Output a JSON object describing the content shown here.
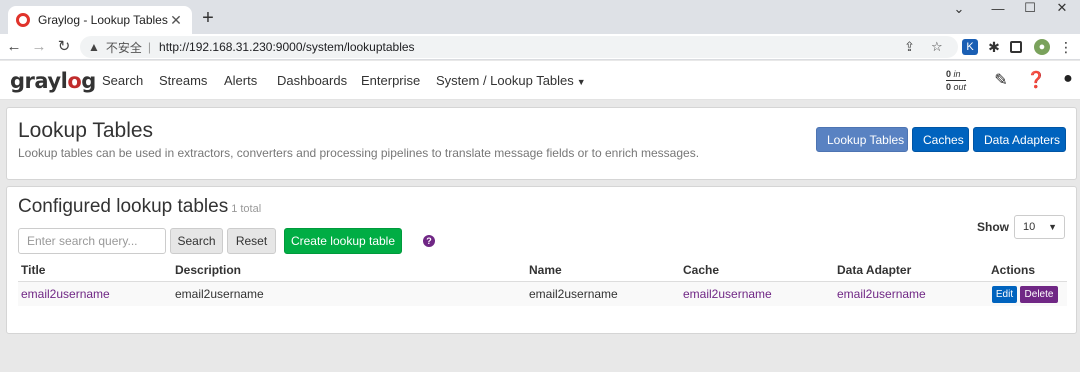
{
  "browser": {
    "tab_title": "Graylog - Lookup Tables",
    "tab_close": "✕",
    "new_tab": "+",
    "controls": {
      "more": "⌄",
      "minimize": "—",
      "maximize": "☐",
      "close": "✕"
    },
    "insecure_label": "不安全",
    "separator": "|",
    "url": "http://192.168.31.230:9000/system/lookuptables"
  },
  "navbar": {
    "brand": {
      "pre": "grayl",
      "o": "o",
      "post": "g"
    },
    "items": [
      "Search",
      "Streams",
      "Alerts",
      "Dashboards",
      "Enterprise"
    ],
    "system_menu": "System / Lookup Tables",
    "throughput": {
      "in_value": "0",
      "in_label": "in",
      "out_value": "0",
      "out_label": "out"
    }
  },
  "header": {
    "title": "Lookup Tables",
    "description": "Lookup tables can be used in extractors, converters and processing pipelines to translate message fields or to enrich messages.",
    "buttons": {
      "lookup_tables": "Lookup Tables",
      "caches": "Caches",
      "data_adapters": "Data Adapters"
    }
  },
  "configured": {
    "title": "Configured lookup tables",
    "total": "1 total",
    "search_placeholder": "Enter search query...",
    "search_button": "Search",
    "reset_button": "Reset",
    "create_button": "Create lookup table",
    "help": "?",
    "show_label": "Show",
    "page_size": "10",
    "columns": {
      "title": "Title",
      "description": "Description",
      "name": "Name",
      "cache": "Cache",
      "data_adapter": "Data Adapter",
      "actions": "Actions"
    },
    "rows": [
      {
        "title": "email2username",
        "description": "email2username",
        "name": "email2username",
        "cache": "email2username",
        "data_adapter": "email2username",
        "edit": "Edit",
        "delete": "Delete"
      }
    ]
  }
}
